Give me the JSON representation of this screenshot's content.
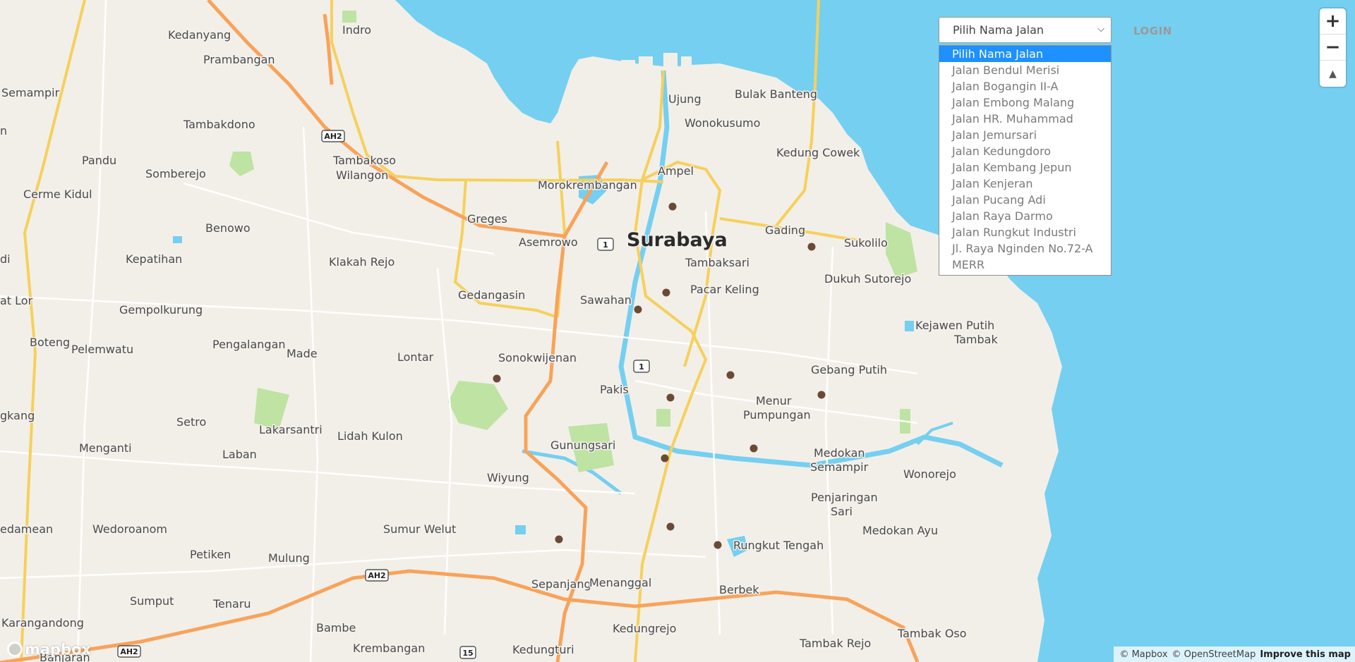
{
  "map": {
    "city": "Surabaya",
    "places": [
      "Kedanyang",
      "Indro",
      "Prambangan",
      "Semampir",
      "Tambakdono",
      "Pandu",
      "Tambakoso",
      "Wilangon",
      "Somberejo",
      "Cerme Kidul",
      "Benowo",
      "Kepatihan",
      "Klakah Rejo",
      "Greges",
      "Asemrowo",
      "Morokrembangan",
      "Ujung",
      "Bulak Banteng",
      "Wonokusumo",
      "Kedung Cowek",
      "Ampel",
      "Gading",
      "Sukolilo",
      "Tambaksari",
      "Pacar Keling",
      "Dukuh Sutorejo",
      "Sawahan",
      "Gedangasin",
      "Gempolkurung",
      "Pengalangan",
      "Boteng",
      "Pelemwatu",
      "Made",
      "Lontar",
      "Sonokwijenan",
      "Pakis",
      "Kejawen Putih",
      "Tambak",
      "Gebang Putih",
      "Menur",
      "Pumpungan",
      "Setro",
      "Lakarsantri",
      "Lidah Kulon",
      "Gunungsari",
      "Menganti",
      "Laban",
      "Wiyung",
      "Medokan",
      "Semampir",
      "Wonorejo",
      "Penjaringan",
      "Sari",
      "Medokan Ayu",
      "Wedoroanom",
      "Sumur Welut",
      "Petiken",
      "Mulung",
      "Rungkut Tengah",
      "Sumput",
      "Tenaru",
      "Sepanjang",
      "Menanggal",
      "Berbek",
      "Karangandong",
      "Bambe",
      "Krembangan",
      "Kedungrejo",
      "Kedungturi",
      "Tambak Rejo",
      "Tambak Oso",
      "Banjaran",
      "di",
      "at Lor",
      "gkang",
      "edamean",
      "n"
    ],
    "shields": [
      "AH2",
      "1",
      "1",
      "AH2",
      "AH2",
      "15"
    ],
    "colors": {
      "water": "#75cff0",
      "land": "#f2efe9",
      "motorway": "#f8a35a",
      "trunk": "#f6d05a",
      "park": "#bfe3a3",
      "marker": "#6b4a35"
    }
  },
  "controls": {
    "street_select": {
      "value": "Pilih Nama Jalan",
      "options": [
        "Pilih Nama Jalan",
        "Jalan Bendul Merisi",
        "Jalan Bogangin II-A",
        "Jalan Embong Malang",
        "Jalan HR. Muhammad",
        "Jalan Jemursari",
        "Jalan Kedungdoro",
        "Jalan Kembang Jepun",
        "Jalan Kenjeran",
        "Jalan Pucang Adi",
        "Jalan Raya Darmo",
        "Jalan Rungkut Industri",
        "Jl. Raya Nginden No.72-A",
        "MERR"
      ]
    },
    "login_label": "LOGIN",
    "zoom_in": "+",
    "zoom_out": "−",
    "compass": "▲"
  },
  "attribution": {
    "mapbox": "© Mapbox",
    "osm": "© OpenStreetMap",
    "improve": "Improve this map",
    "logo": "mapbox"
  }
}
